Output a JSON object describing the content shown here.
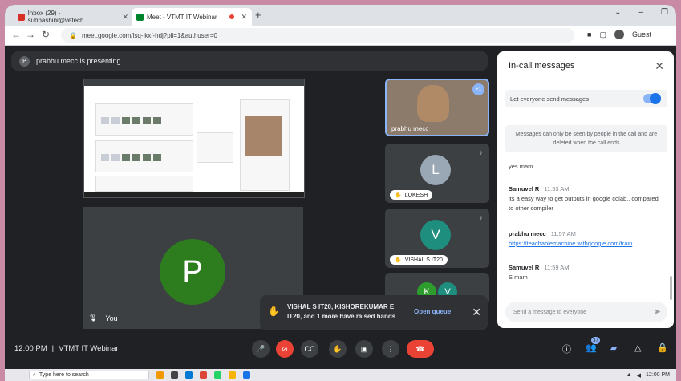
{
  "browser": {
    "tab_inactive": "Inbox (29) - subhashini@vetech...",
    "tab_active": "Meet - VTMT IT Webinar",
    "url": "meet.google.com/lsq-ikxf-hdj?pli=1&authuser=0",
    "guest_label": "Guest"
  },
  "meet": {
    "presenting_initial": "P",
    "presenting_text": "prabhu mecc is presenting",
    "big_tile_initial": "P",
    "you_label": "You",
    "tiles": [
      {
        "name": "prabhu mecc",
        "extra": "+1"
      },
      {
        "name": "LOKESH",
        "initial": "L",
        "color": "#9aa7b5"
      },
      {
        "name": "VISHAL S IT20",
        "initial": "V",
        "color": "#1e8e7e"
      },
      {
        "initials": [
          "K",
          "V"
        ]
      }
    ],
    "raised_hands": "VISHAL S IT20, KISHOREKUMAR E IT20, and 1 more have raised hands",
    "open_queue": "Open queue",
    "time": "12:00 PM",
    "separator": "|",
    "meeting_name": "VTMT IT Webinar",
    "people_count": "37"
  },
  "panel": {
    "title": "In-call messages",
    "everyone_label": "Let everyone send messages",
    "notice": "Messages can only be seen by people in the call and are deleted when the call ends",
    "messages": [
      {
        "text": "yes mam"
      },
      {
        "sender": "Samuvel R",
        "time": "11:53 AM",
        "text": "its a easy way to get outputs in google colab.. compared to other compiler"
      },
      {
        "sender": "prabhu mecc",
        "time": "11:57 AM",
        "link": "https://teachablemachine.withgoogle.com/train"
      },
      {
        "sender": "Samuvel R",
        "time": "11:59 AM",
        "text": "S mam"
      }
    ],
    "send_placeholder": "Send a message to everyone"
  },
  "taskbar": {
    "search_placeholder": "Type here to search",
    "clock": "12:00 PM"
  },
  "colors": {
    "accent": "#8ab4f8",
    "end_call": "#ea4335",
    "avatar_green": "#2d7d1f"
  }
}
